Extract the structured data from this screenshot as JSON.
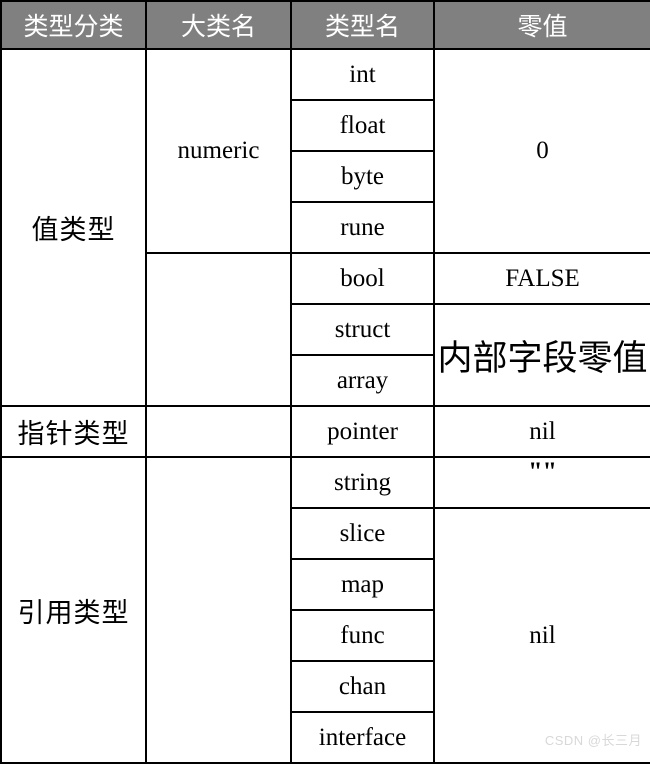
{
  "table": {
    "headers": [
      "类型分类",
      "大类名",
      "类型名",
      "零值"
    ],
    "groups": [
      {
        "category": "值类型",
        "rows": [
          {
            "big_type": "numeric",
            "type_name": "int",
            "zero_value": "0"
          },
          {
            "big_type": "",
            "type_name": "float",
            "zero_value": ""
          },
          {
            "big_type": "",
            "type_name": "byte",
            "zero_value": ""
          },
          {
            "big_type": "",
            "type_name": "rune",
            "zero_value": ""
          },
          {
            "big_type": "",
            "type_name": "bool",
            "zero_value": "FALSE"
          },
          {
            "big_type": "",
            "type_name": "struct",
            "zero_value": "内部字段零值"
          },
          {
            "big_type": "",
            "type_name": "array",
            "zero_value": ""
          }
        ]
      },
      {
        "category": "指针类型",
        "rows": [
          {
            "big_type": "",
            "type_name": "pointer",
            "zero_value": "nil"
          }
        ]
      },
      {
        "category": "引用类型",
        "rows": [
          {
            "big_type": "",
            "type_name": "string",
            "zero_value": "\"\""
          },
          {
            "big_type": "",
            "type_name": "slice",
            "zero_value": "nil"
          },
          {
            "big_type": "",
            "type_name": "map",
            "zero_value": ""
          },
          {
            "big_type": "",
            "type_name": "func",
            "zero_value": ""
          },
          {
            "big_type": "",
            "type_name": "chan",
            "zero_value": ""
          },
          {
            "big_type": "",
            "type_name": "interface",
            "zero_value": ""
          }
        ]
      }
    ],
    "cells": {
      "category_value": "值类型",
      "category_pointer": "指针类型",
      "category_reference": "引用类型",
      "big_type_numeric": "numeric",
      "type_int": "int",
      "type_float": "float",
      "type_byte": "byte",
      "type_rune": "rune",
      "type_bool": "bool",
      "type_struct": "struct",
      "type_array": "array",
      "type_pointer": "pointer",
      "type_string": "string",
      "type_slice": "slice",
      "type_map": "map",
      "type_func": "func",
      "type_chan": "chan",
      "type_interface": "interface",
      "zero_numeric": "0",
      "zero_bool": "FALSE",
      "zero_struct_array": "内部字段零值",
      "zero_pointer": "nil",
      "zero_string": "\"\"",
      "zero_reference": "nil"
    }
  },
  "watermark": {
    "text": "CSDN @长三月"
  },
  "colors": {
    "header_background": "#808080",
    "header_text": "#ffffff",
    "border": "#000000",
    "cell_background": "#ffffff",
    "cell_text": "#000000",
    "watermark_text": "#d8d8d8"
  }
}
